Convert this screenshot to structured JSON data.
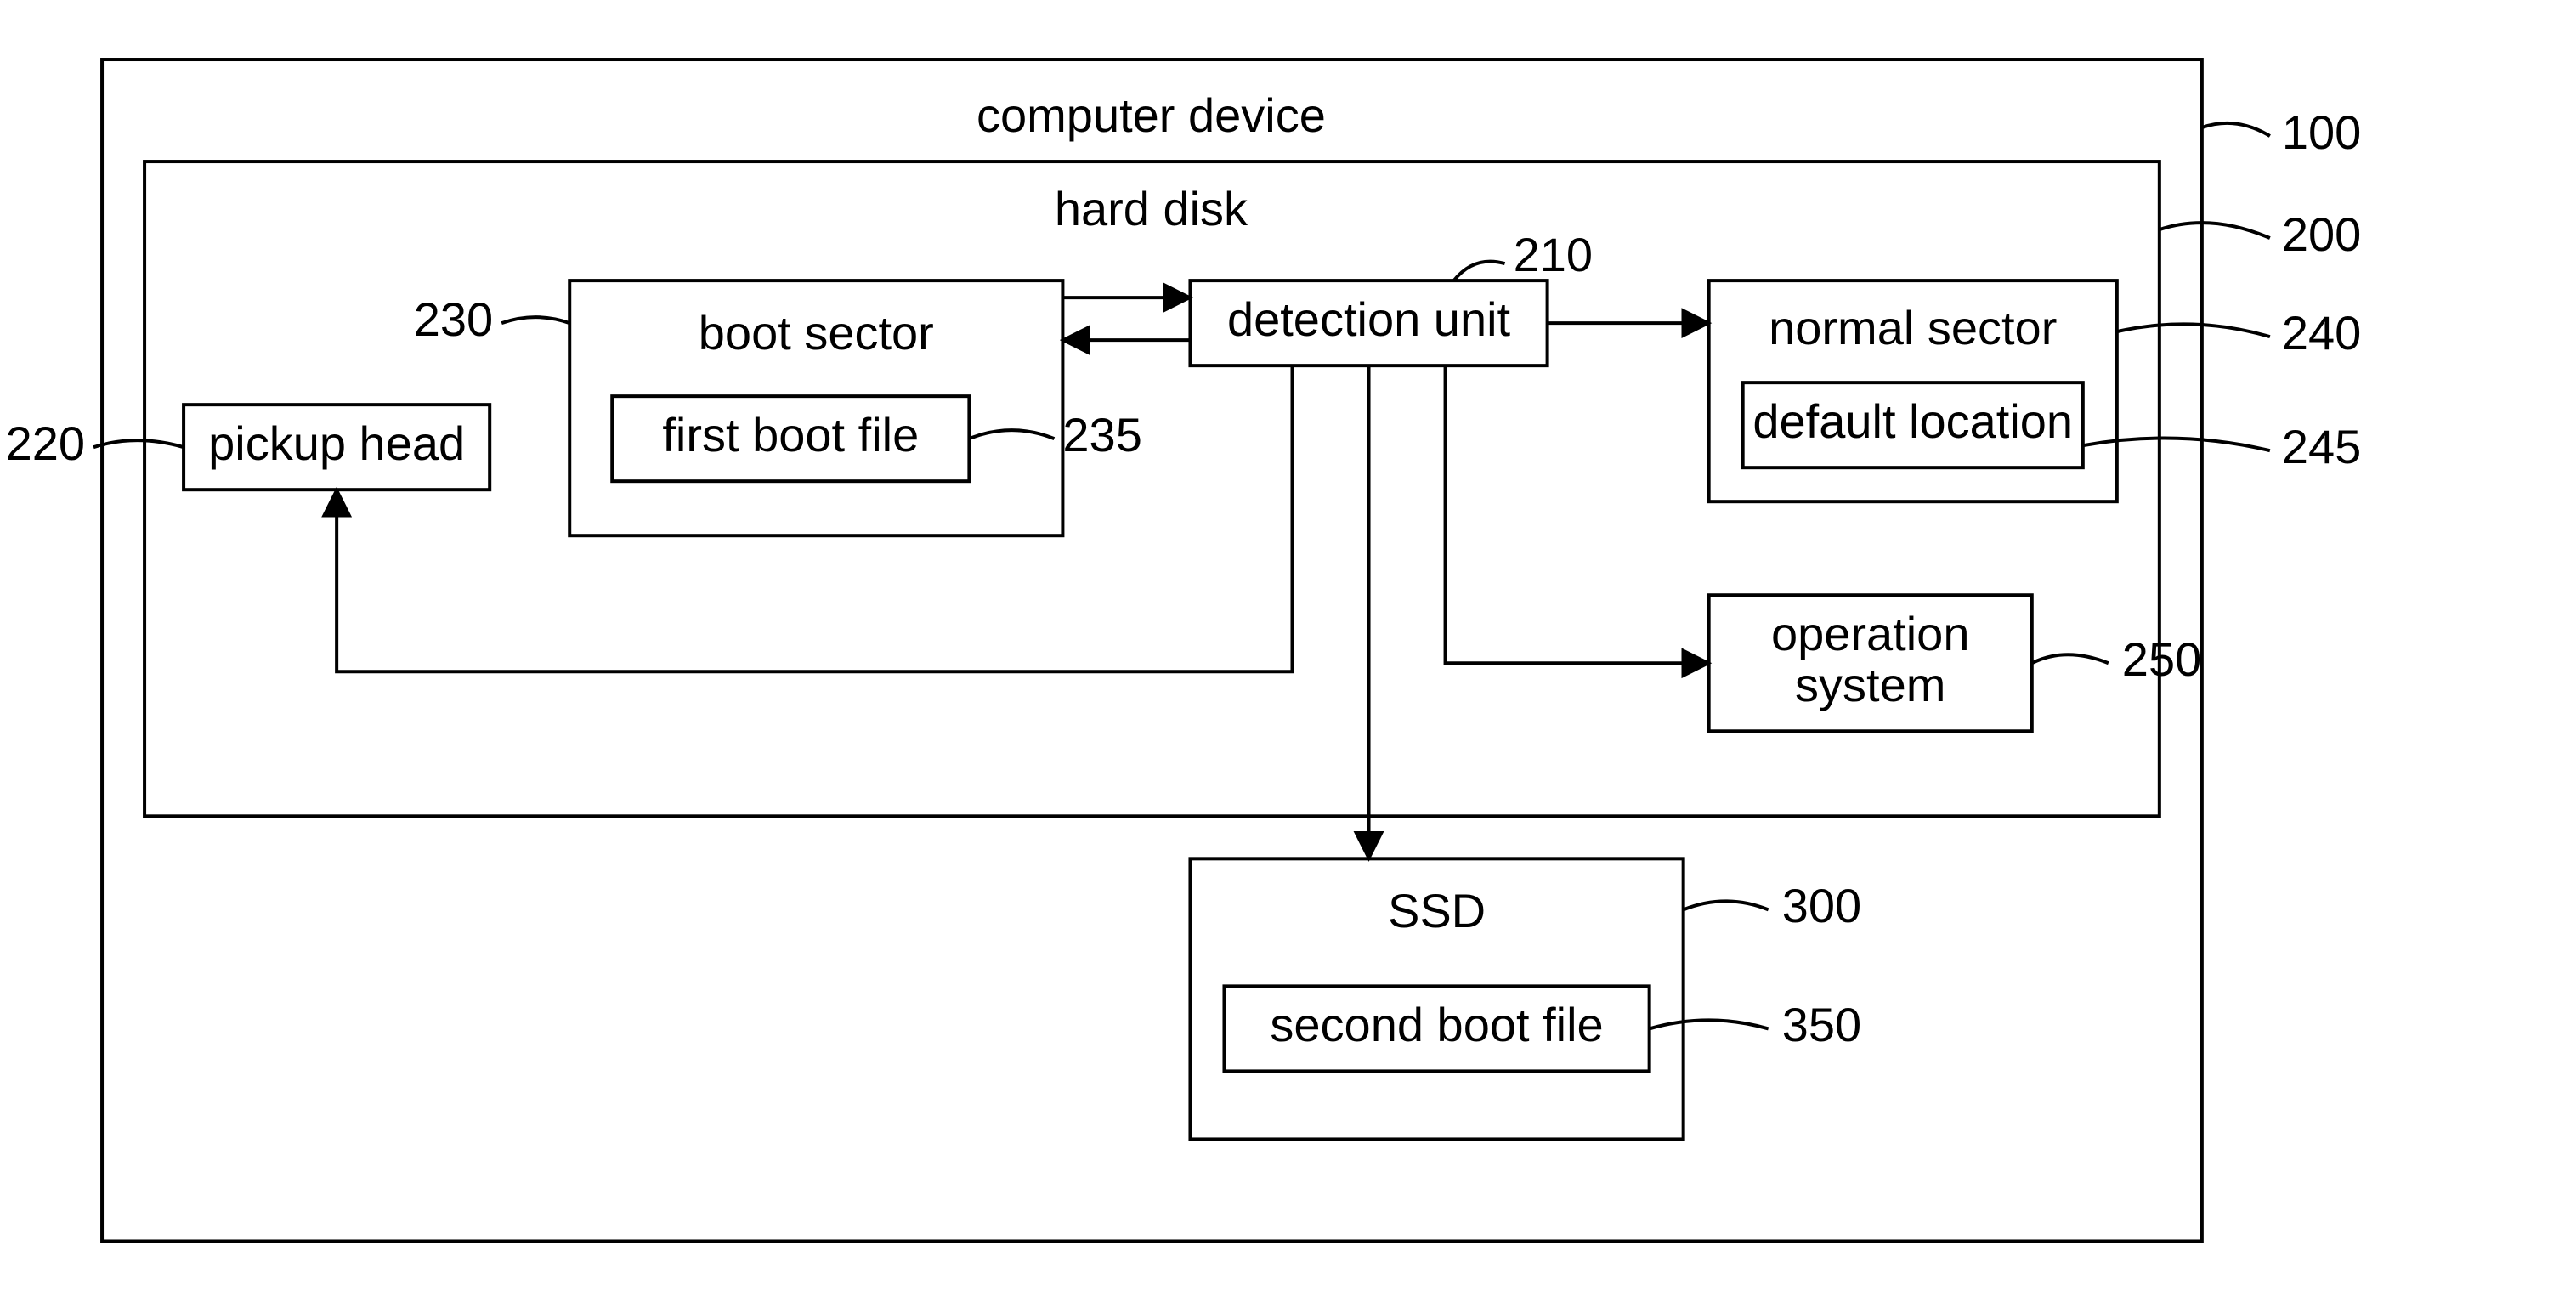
{
  "blocks": {
    "computer_device": {
      "label": "computer device",
      "ref": "100"
    },
    "hard_disk": {
      "label": "hard disk",
      "ref": "200"
    },
    "pickup_head": {
      "label": "pickup head",
      "ref": "220"
    },
    "boot_sector": {
      "label": "boot sector",
      "ref": "230"
    },
    "first_boot_file": {
      "label": "first boot file",
      "ref": "235"
    },
    "detection_unit": {
      "label": "detection unit",
      "ref": "210"
    },
    "normal_sector": {
      "label": "normal sector",
      "ref": "240"
    },
    "default_location": {
      "label": "default location",
      "ref": "245"
    },
    "operation_system": {
      "label": "operation\nsystem",
      "ref": "250"
    },
    "ssd": {
      "label": "SSD",
      "ref": "300"
    },
    "second_boot_file": {
      "label": "second boot file",
      "ref": "350"
    }
  },
  "connections": [
    {
      "from": "boot_sector",
      "to": "detection_unit",
      "bidir": true
    },
    {
      "from": "detection_unit",
      "to": "normal_sector"
    },
    {
      "from": "detection_unit",
      "to": "pickup_head"
    },
    {
      "from": "detection_unit",
      "to": "operation_system"
    },
    {
      "from": "detection_unit",
      "to": "ssd"
    }
  ]
}
